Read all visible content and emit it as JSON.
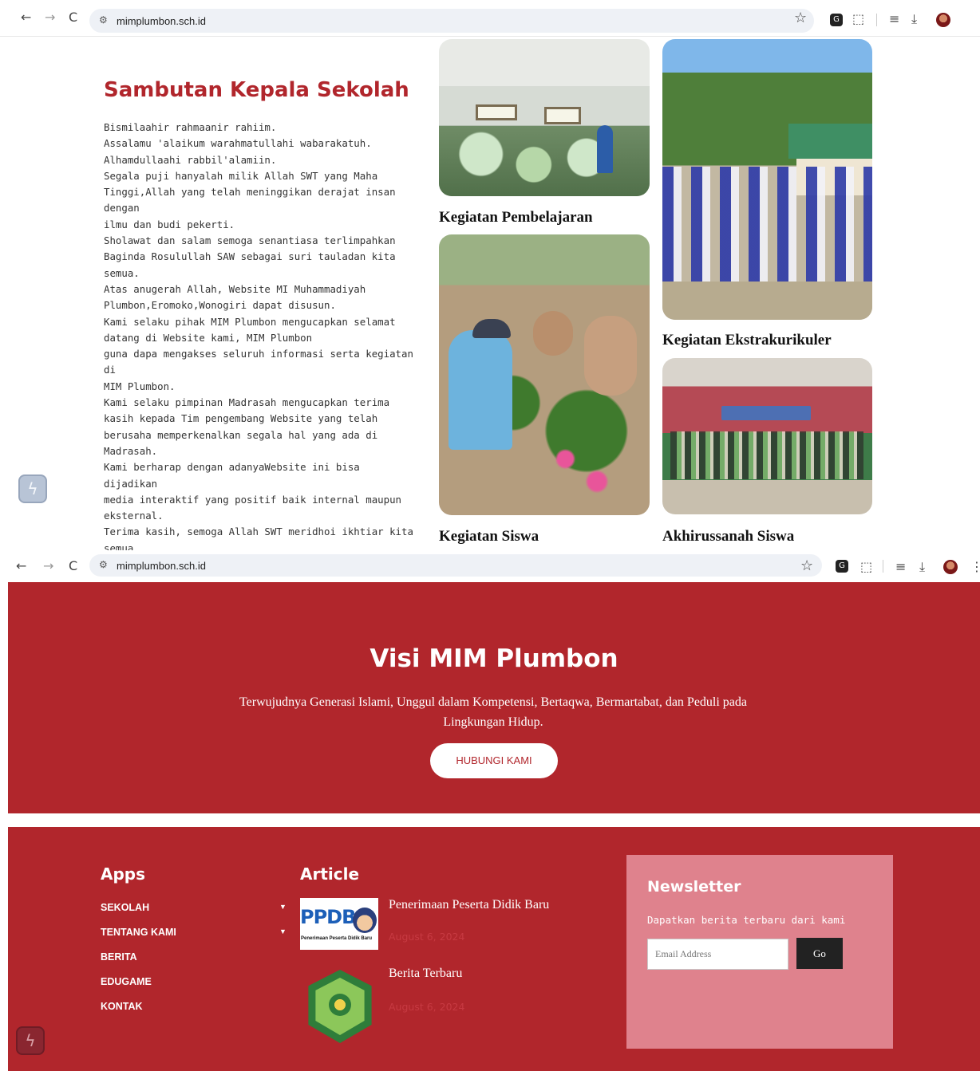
{
  "browser": {
    "back_icon": "←",
    "forward_icon": "→",
    "reload_icon": "C",
    "site_info_icon": "⚙",
    "url": "mimplumbon.sch.id",
    "star_icon": "☆",
    "extension_icon": "G",
    "puzzle_icon": "⬚",
    "reading_list_icon": "≡",
    "download_icon": "⤓",
    "menu_icon": "⋮"
  },
  "sambutan": {
    "title": "Sambutan Kepala Sekolah",
    "body": "Bismilaahir rahmaanir rahiim.\nAssalamu 'alaikum warahmatullahi wabarakatuh.\nAlhamdullaahi rabbil'alamiin.\nSegala puji hanyalah milik Allah SWT yang Maha\nTinggi,Allah yang telah meninggikan derajat insan dengan\nilmu dan budi pekerti.\nSholawat dan salam semoga senantiasa terlimpahkan\nBaginda Rosulullah SAW sebagai suri tauladan kita semua.\nAtas anugerah Allah, Website MI Muhammadiyah\nPlumbon,Eromoko,Wonogiri dapat disusun.\nKami selaku pihak MIM Plumbon mengucapkan selamat\ndatang di Website kami, MIM Plumbon\nguna dapa mengakses seluruh informasi serta kegiatan di\nMIM Plumbon.\nKami selaku pimpinan Madrasah mengucapkan terima\nkasih kepada Tim pengembang Website yang telah\nberusaha memperkenalkan segala hal yang ada di\nMadrasah.\nKami berharap dengan adanyaWebsite ini bisa dijadikan\nmedia interaktif yang positif baik internal maupun\neksternal.\nTerima kasih, semoga Allah SWT meridhoi ikhtiar kita\nsemua.\nWassalamu'alaikum warahmatullahi wabarakatuh."
  },
  "gallery": {
    "pembelajaran": "Kegiatan Pembelajaran",
    "ekstrakurikuler": "Kegiatan Ekstrakurikuler",
    "siswa": "Kegiatan Siswa",
    "akhirussanah": "Akhirussanah Siswa"
  },
  "visi": {
    "title": "Visi MIM Plumbon",
    "text": "Terwujudnya Generasi Islami, Unggul dalam Kompetensi, Bertaqwa, Bermartabat, dan Peduli pada Lingkungan Hidup.",
    "button": "HUBUNGI KAMI"
  },
  "footer": {
    "apps_title": "Apps",
    "apps": [
      {
        "label": "SEKOLAH",
        "caret": "▼"
      },
      {
        "label": "TENTANG KAMI",
        "caret": "▼"
      },
      {
        "label": "BERITA"
      },
      {
        "label": "EDUGAME"
      },
      {
        "label": "KONTAK"
      }
    ],
    "article_title": "Article",
    "articles": [
      {
        "title": "Penerimaan Peserta Didik Baru",
        "date": "August 6, 2024",
        "thumb_text": "PPDB",
        "thumb_sub": "Penerimaan Peserta Didik Baru"
      },
      {
        "title": "Berita Terbaru",
        "date": "August 6, 2024"
      }
    ],
    "newsletter": {
      "title": "Newsletter",
      "text": "Dapatkan berita terbaru dari kami",
      "placeholder": "Email Address",
      "button": "Go"
    }
  },
  "colors": {
    "brand_red": "#b1262c",
    "newsletter_pink": "#df828d"
  }
}
